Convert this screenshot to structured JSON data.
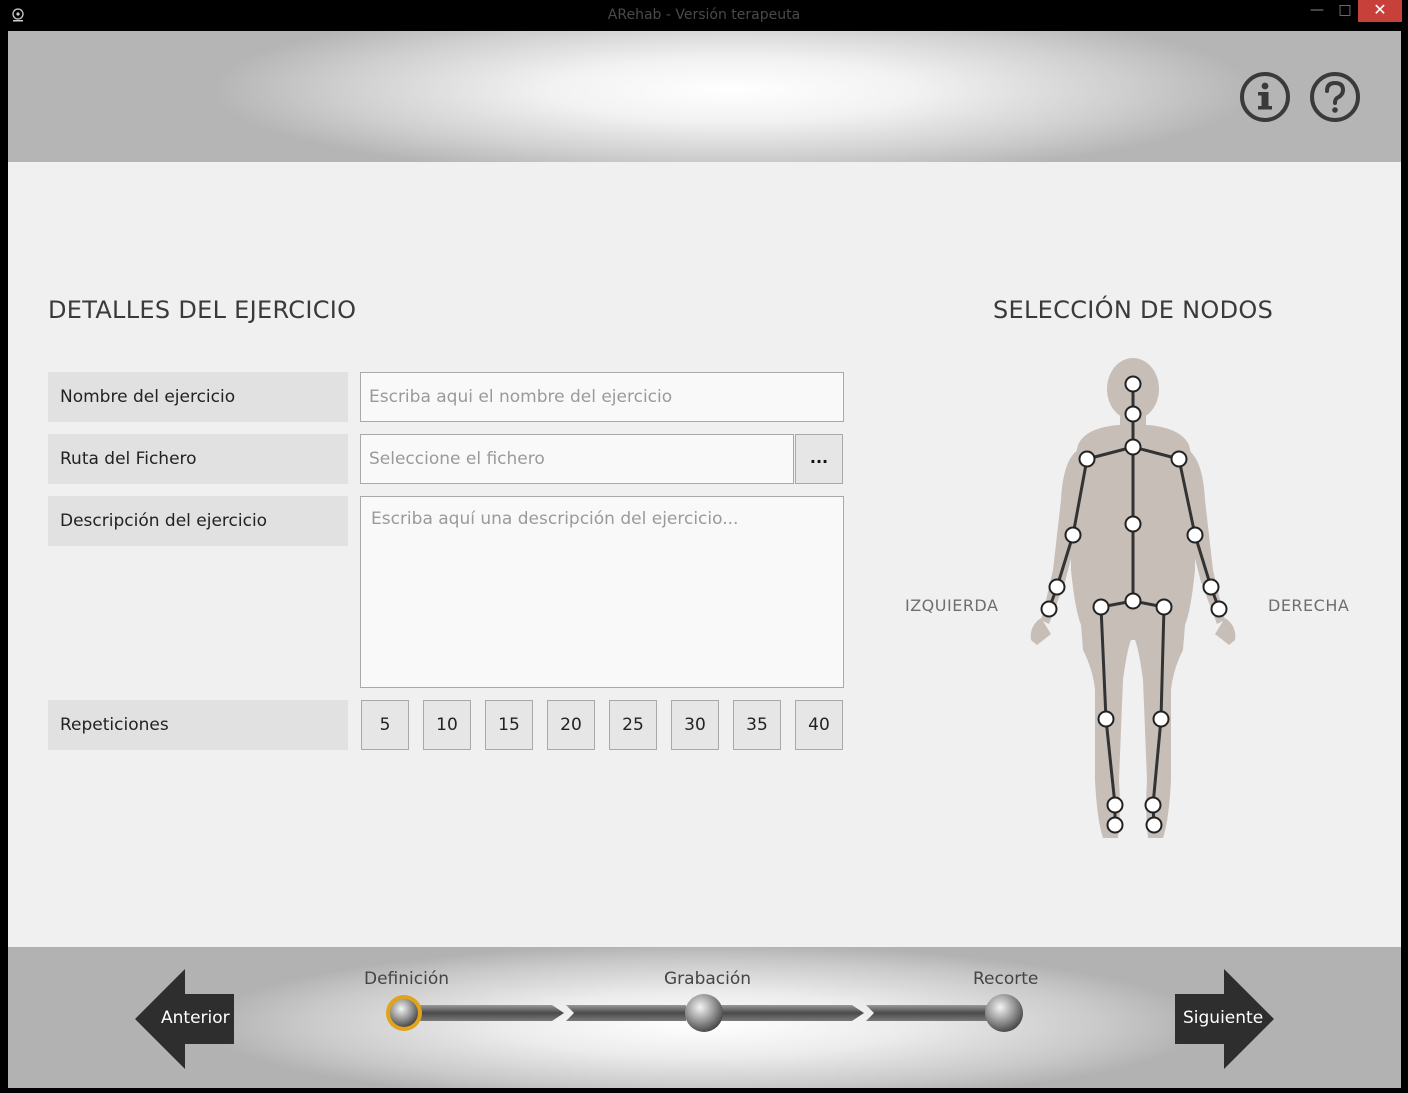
{
  "window": {
    "title": "ARehab - Versión terapeuta",
    "minimize_glyph": "—",
    "maximize_glyph": "□",
    "close_glyph": "✕"
  },
  "header": {
    "info_icon": "info-icon",
    "help_icon": "help-icon"
  },
  "exercise_details": {
    "title": "DETALLES DEL EJERCICIO",
    "name_label": "Nombre del ejercicio",
    "name_placeholder": "Escriba aqui el nombre del ejercicio",
    "file_label": "Ruta del Fichero",
    "file_placeholder": "Seleccione el fichero",
    "browse_label": "...",
    "description_label": "Descripción del ejercicio",
    "description_placeholder": "Escriba aquí una descripción del ejercicio...",
    "repetitions_label": "Repeticiones",
    "repetitions": [
      "5",
      "10",
      "15",
      "20",
      "25",
      "30",
      "35",
      "40"
    ]
  },
  "node_selection": {
    "title": "SELECCIÓN DE NODOS",
    "left_label": "IZQUIERDA",
    "right_label": "DERECHA"
  },
  "footer": {
    "prev_label": "Anterior",
    "next_label": "Siguiente",
    "steps": [
      "Definición",
      "Grabación",
      "Recorte"
    ],
    "active_step": 0,
    "accent_color": "#e0a31a"
  }
}
